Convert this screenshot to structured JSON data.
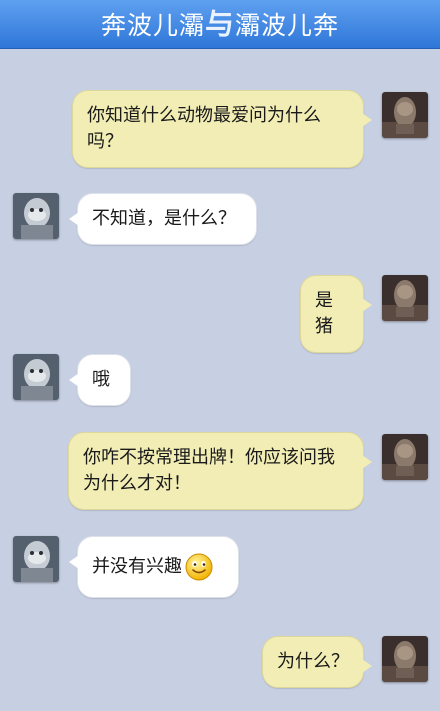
{
  "header": {
    "title_left": "奔波儿灞",
    "title_sep": "与",
    "title_right": "灞波儿奔"
  },
  "messages": [
    {
      "sender": "me",
      "text": "你知道什么动物最爱问为什么吗？"
    },
    {
      "sender": "them",
      "text": "不知道，是什么？"
    },
    {
      "sender": "me",
      "text": "是猪"
    },
    {
      "sender": "them",
      "text": "哦"
    },
    {
      "sender": "me",
      "text": "你咋不按常理出牌！你应该问我为什么才对！"
    },
    {
      "sender": "them",
      "text": "并没有兴趣",
      "emoji": "smiley-face-icon"
    },
    {
      "sender": "me",
      "text": "为什么？"
    }
  ],
  "colors": {
    "title_bar": "#3f86e2",
    "background": "#c7cfe2",
    "my_bubble": "#f1edb4",
    "their_bubble": "#ffffff"
  }
}
